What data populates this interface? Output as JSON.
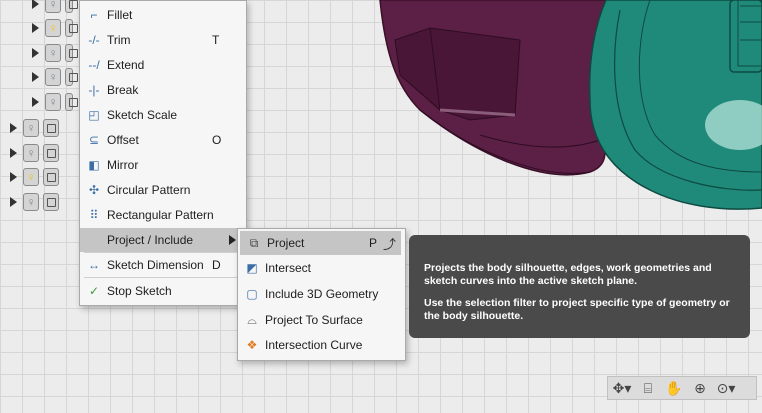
{
  "sketch_menu": {
    "items": [
      {
        "icon": "fillet-icon",
        "label": "Fillet",
        "shortcut": ""
      },
      {
        "icon": "trim-icon",
        "label": "Trim",
        "shortcut": "T"
      },
      {
        "icon": "extend-icon",
        "label": "Extend",
        "shortcut": ""
      },
      {
        "icon": "break-icon",
        "label": "Break",
        "shortcut": ""
      },
      {
        "icon": "sketch-scale-icon",
        "label": "Sketch Scale",
        "shortcut": ""
      },
      {
        "icon": "offset-icon",
        "label": "Offset",
        "shortcut": "O"
      },
      {
        "icon": "mirror-icon",
        "label": "Mirror",
        "shortcut": ""
      },
      {
        "icon": "circular-pattern-icon",
        "label": "Circular Pattern",
        "shortcut": ""
      },
      {
        "icon": "rectangular-pattern-icon",
        "label": "Rectangular Pattern",
        "shortcut": ""
      },
      {
        "icon": "",
        "label": "Project / Include",
        "shortcut": ""
      },
      {
        "icon": "sketch-dimension-icon",
        "label": "Sketch Dimension",
        "shortcut": "D"
      },
      {
        "icon": "stop-sketch-icon",
        "label": "Stop Sketch",
        "shortcut": ""
      }
    ]
  },
  "project_submenu": {
    "items": [
      {
        "icon": "project-icon",
        "label": "Project",
        "shortcut": "P"
      },
      {
        "icon": "intersect-icon",
        "label": "Intersect",
        "shortcut": ""
      },
      {
        "icon": "include-3d-geometry-icon",
        "label": "Include 3D Geometry",
        "shortcut": ""
      },
      {
        "icon": "project-to-surface-icon",
        "label": "Project To Surface",
        "shortcut": ""
      },
      {
        "icon": "intersection-curve-icon",
        "label": "Intersection Curve",
        "shortcut": ""
      }
    ]
  },
  "tooltip": {
    "line1": "Projects the body silhouette, edges, work geometries and sketch curves into the active sketch plane.",
    "line2": "Use the selection filter to project specific type of geometry or the body silhouette."
  },
  "colors": {
    "model_purple": "#5c1f45",
    "model_teal": "#1f8a7a",
    "menu_bg": "#f6f6f6",
    "highlight": "#c5c5c5",
    "tooltip_bg": "#4a4a4a"
  }
}
